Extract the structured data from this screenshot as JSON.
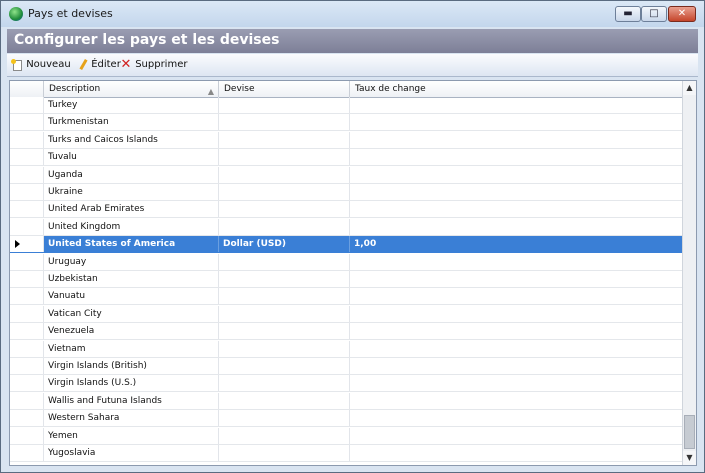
{
  "window": {
    "title": "Pays et devises",
    "min_glyph": "▬",
    "max_glyph": "□",
    "close_glyph": "✕"
  },
  "header": {
    "title": "Configurer les pays et les devises"
  },
  "toolbar": {
    "new_label": "Nouveau",
    "edit_label": "Éditer",
    "delete_label": "Supprimer"
  },
  "grid": {
    "columns": [
      "Description",
      "Devise",
      "Taux de change"
    ],
    "rows": [
      {
        "description": "Turkey",
        "devise": "",
        "taux": ""
      },
      {
        "description": "Turkmenistan",
        "devise": "",
        "taux": ""
      },
      {
        "description": "Turks and Caicos Islands",
        "devise": "",
        "taux": ""
      },
      {
        "description": "Tuvalu",
        "devise": "",
        "taux": ""
      },
      {
        "description": "Uganda",
        "devise": "",
        "taux": ""
      },
      {
        "description": "Ukraine",
        "devise": "",
        "taux": ""
      },
      {
        "description": "United Arab Emirates",
        "devise": "",
        "taux": ""
      },
      {
        "description": "United Kingdom",
        "devise": "",
        "taux": ""
      },
      {
        "description": "United States of America",
        "devise": "Dollar (USD)",
        "taux": "1,00"
      },
      {
        "description": "Uruguay",
        "devise": "",
        "taux": ""
      },
      {
        "description": "Uzbekistan",
        "devise": "",
        "taux": ""
      },
      {
        "description": "Vanuatu",
        "devise": "",
        "taux": ""
      },
      {
        "description": "Vatican City",
        "devise": "",
        "taux": ""
      },
      {
        "description": "Venezuela",
        "devise": "",
        "taux": ""
      },
      {
        "description": "Vietnam",
        "devise": "",
        "taux": ""
      },
      {
        "description": "Virgin Islands (British)",
        "devise": "",
        "taux": ""
      },
      {
        "description": "Virgin Islands (U.S.)",
        "devise": "",
        "taux": ""
      },
      {
        "description": "Wallis and Futuna Islands",
        "devise": "",
        "taux": ""
      },
      {
        "description": "Western Sahara",
        "devise": "",
        "taux": ""
      },
      {
        "description": "Yemen",
        "devise": "",
        "taux": ""
      },
      {
        "description": "Yugoslavia",
        "devise": "",
        "taux": ""
      }
    ],
    "selected_index": 8
  },
  "colors": {
    "selection": "#3a7fd6",
    "header_bar": "#8a8ca4"
  },
  "icons": {
    "sort": "▲",
    "scroll_up": "▲",
    "scroll_down": "▼"
  }
}
